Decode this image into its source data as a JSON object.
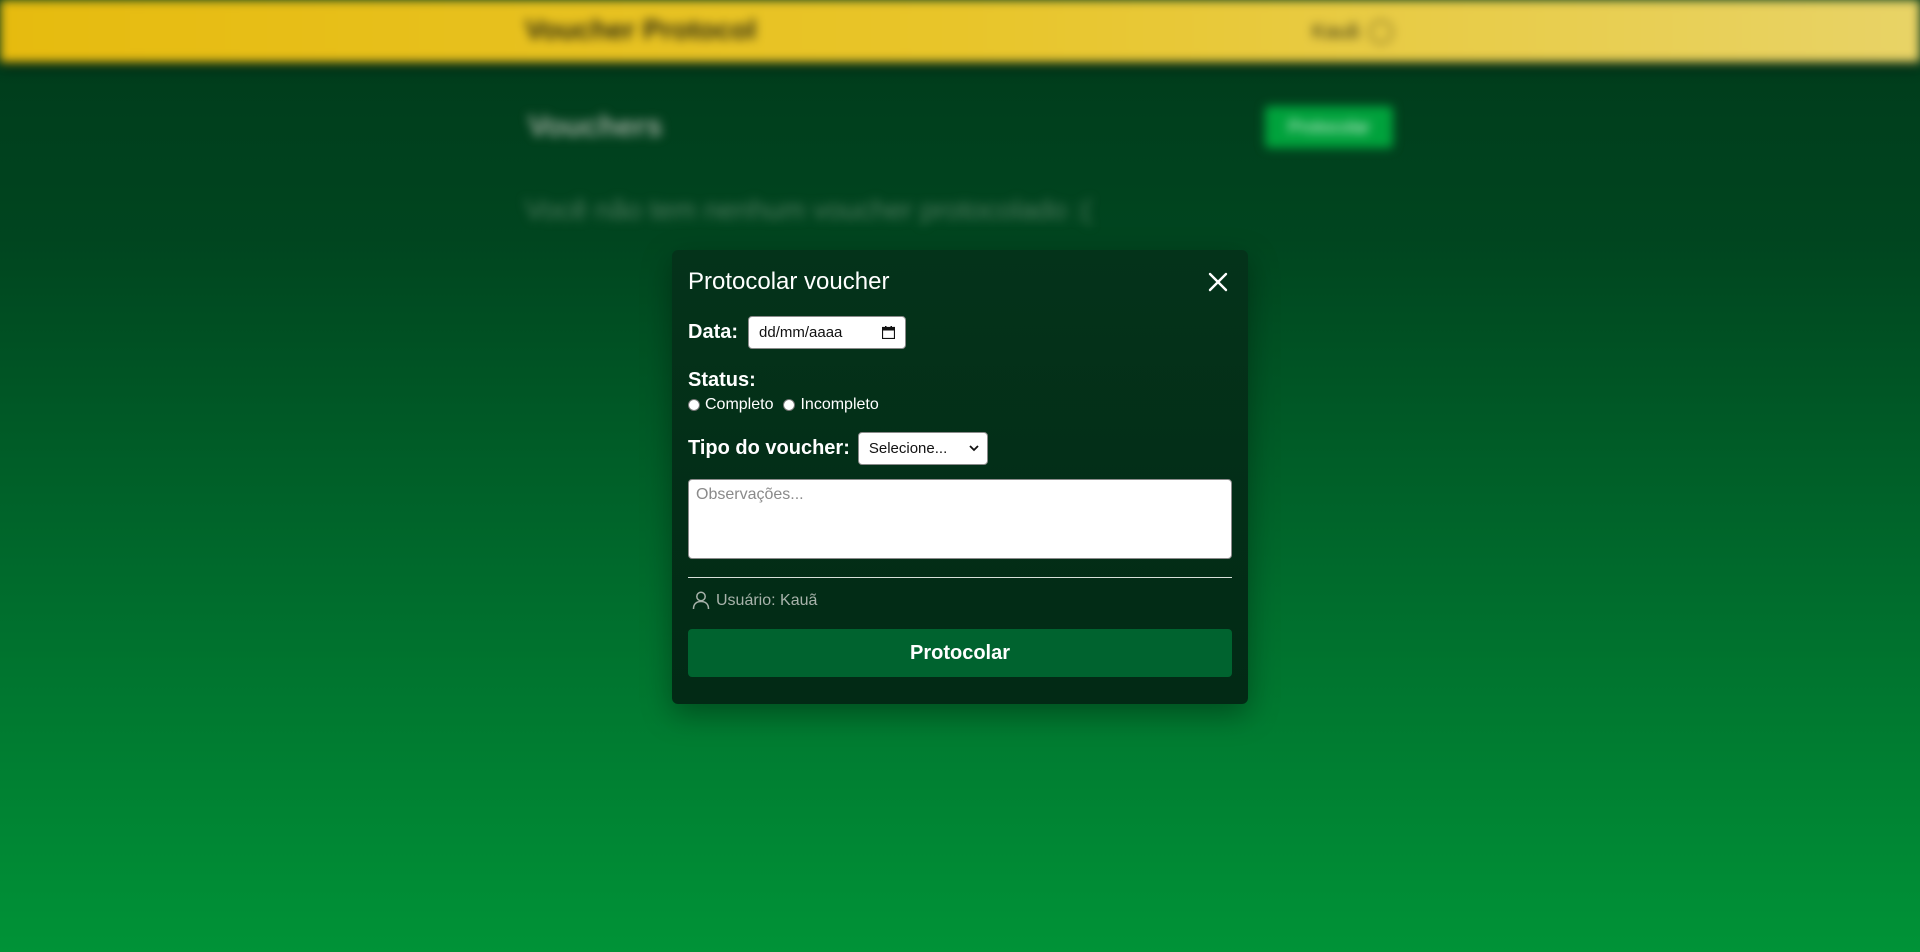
{
  "background": {
    "app_title": "Voucher Protocol",
    "user_label": "Kauã",
    "heading": "Vouchers",
    "new_button": "Protocolar",
    "empty_message": "Você não tem nenhum voucher protocolado :("
  },
  "modal": {
    "title": "Protocolar voucher",
    "date_label": "Data:",
    "date_placeholder": "dd/mm/aaaa",
    "status_label": "Status:",
    "status_options": [
      "Completo",
      "Incompleto"
    ],
    "tipo_label": "Tipo do voucher:",
    "tipo_selected": "Selecione...",
    "observacoes_placeholder": "Observações...",
    "user_text": "Usuário: Kauã",
    "submit_label": "Protocolar"
  },
  "colors": {
    "topbar": "#e6bb0f",
    "modal_bg": "#04331a",
    "submit_bg": "#00632f",
    "page_gradient_bottom": "#009337"
  },
  "icons": {
    "close": "close-icon",
    "calendar": "calendar-icon",
    "user": "user-icon",
    "chevron": "chevron-down-icon"
  }
}
